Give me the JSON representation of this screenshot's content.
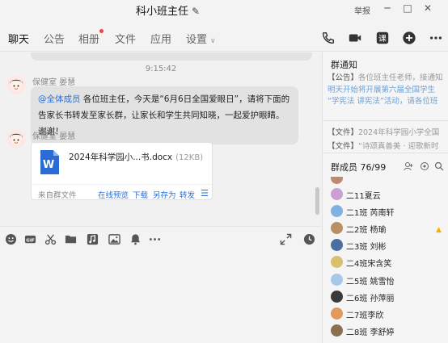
{
  "window": {
    "title": "科小班主任",
    "report": "举报",
    "edit_icon": "pencil-icon",
    "controls": [
      "minimize-icon",
      "restore-icon",
      "close-icon"
    ]
  },
  "tabs": [
    {
      "label": "聊天",
      "active": true
    },
    {
      "label": "公告"
    },
    {
      "label": "相册",
      "badge": true
    },
    {
      "label": "文件"
    },
    {
      "label": "应用"
    },
    {
      "label": "设置",
      "dropdown": true
    }
  ],
  "header_actions": [
    "phone-icon",
    "video-call-icon",
    "lesson-icon",
    "add-icon",
    "more-icon"
  ],
  "chat": {
    "timestamp": "9:15:42",
    "messages": [
      {
        "sender": "保健室 晏慧",
        "mention": "@全体成员",
        "text": " 各位班主任，今天是“6月6日全国爱眼日”，请将下面的告家长书转发至家长群，让家长和学生共同知晓，一起爱护眼睛。谢谢！"
      },
      {
        "sender": "保健室 晏慧",
        "file": {
          "name": "2024年科学园小...书.docx",
          "size": "(12KB)",
          "source": "来自群文件",
          "actions": [
            "在线预览",
            "下载",
            "另存为",
            "转发"
          ]
        }
      }
    ]
  },
  "toolbar": [
    "emoji-icon",
    "gif-icon",
    "scissors-icon",
    "folder-icon",
    "music-icon",
    "image-icon",
    "bell-icon",
    "more-icon",
    "expand-icon",
    "history-icon"
  ],
  "sidebar": {
    "notice_title": "群通知",
    "notices": [
      {
        "tag": "【公告】",
        "text": "各位班主任老师，接通知：从"
      },
      {
        "tag": "",
        "text": "明天开始将开展第六届全国学生"
      },
      {
        "tag": "",
        "text": "“学宪法 讲宪法”活动，请各位班"
      },
      {
        "tag": "【文件】",
        "text": "2024年科学园小学全国"
      },
      {
        "tag": "【文件】",
        "text": "“诗颂真善美 · 迎歌新时"
      }
    ],
    "members_title": "群成员 76/99",
    "members": [
      {
        "name": "二11夏云",
        "color": "#c9a0d4"
      },
      {
        "name": "二1班 芮南轩",
        "color": "#7fb2e0"
      },
      {
        "name": "二2班 杨瑜",
        "color": "#b89063"
      },
      {
        "name": "二3班 刘彬",
        "color": "#4a6fa0"
      },
      {
        "name": "二4班宋含笑",
        "color": "#d9c070"
      },
      {
        "name": "二5班 姚雪怡",
        "color": "#a8c8e8"
      },
      {
        "name": "二6班 孙萍丽",
        "color": "#3a3a3a"
      },
      {
        "name": "二7班李欣",
        "color": "#e09a60"
      },
      {
        "name": "二8班 李舒婷",
        "color": "#8a7050"
      }
    ]
  },
  "colors": {
    "accent": "#2a6fd6",
    "badge": "#f04040",
    "crown": "#f0b400"
  }
}
